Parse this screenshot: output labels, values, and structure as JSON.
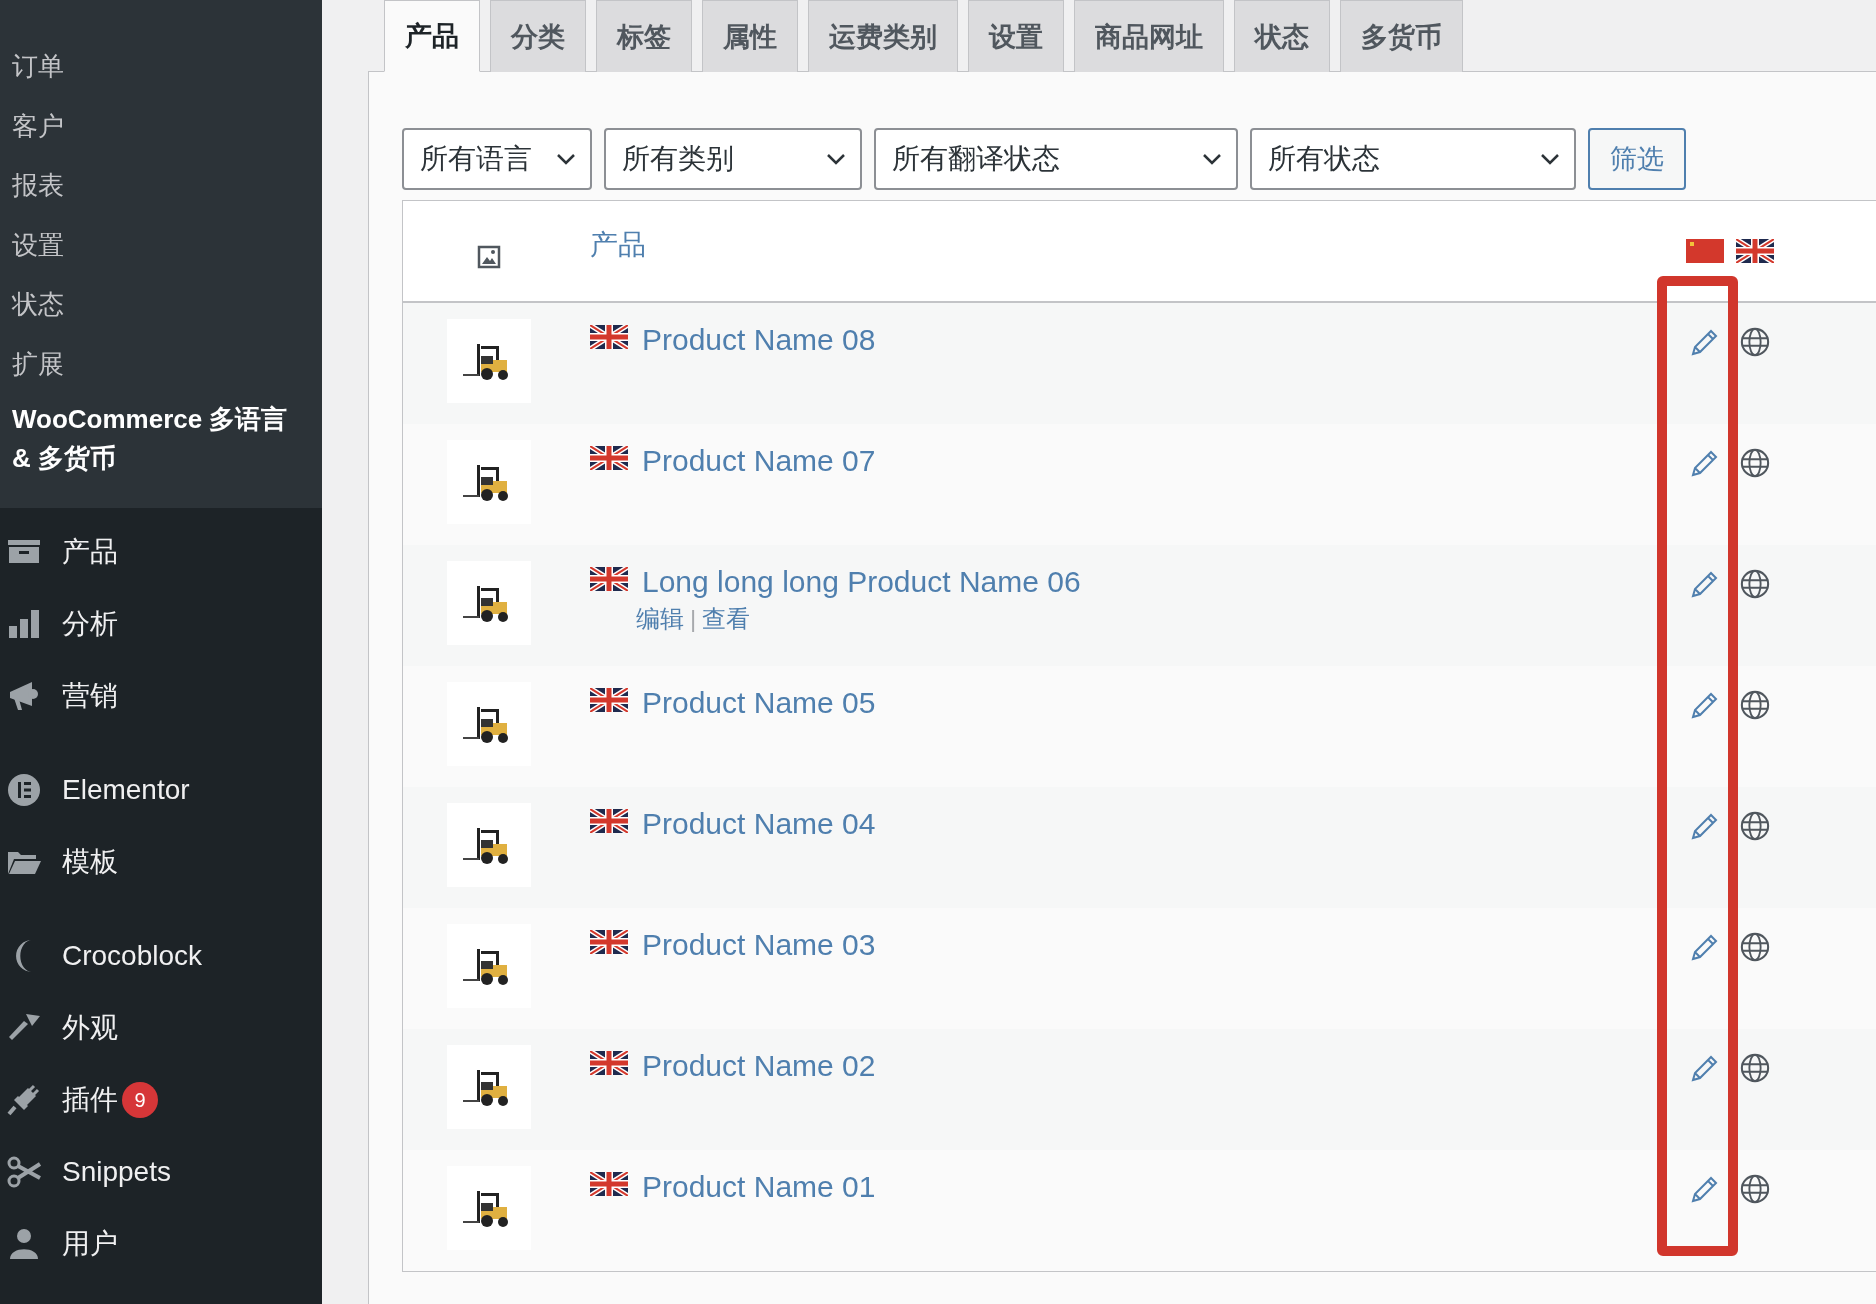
{
  "sidebar": {
    "submenu": [
      {
        "label": "订单"
      },
      {
        "label": "客户"
      },
      {
        "label": "报表"
      },
      {
        "label": "设置"
      },
      {
        "label": "状态"
      },
      {
        "label": "扩展"
      }
    ],
    "current_plugin": "WooCommerce 多语言 & 多货币",
    "menu_groups": [
      [
        {
          "label": "产品"
        },
        {
          "label": "分析"
        },
        {
          "label": "营销"
        }
      ],
      [
        {
          "label": "Elementor"
        },
        {
          "label": "模板"
        }
      ],
      [
        {
          "label": "Crocoblock"
        },
        {
          "label": "外观"
        },
        {
          "label": "插件",
          "badge": "9"
        },
        {
          "label": "Snippets"
        },
        {
          "label": "用户"
        }
      ]
    ]
  },
  "tabs": [
    {
      "label": "产品",
      "selected": true
    },
    {
      "label": "分类",
      "selected": false
    },
    {
      "label": "标签",
      "selected": false
    },
    {
      "label": "属性",
      "selected": false
    },
    {
      "label": "运费类别",
      "selected": false
    },
    {
      "label": "设置",
      "selected": false
    },
    {
      "label": "商品网址",
      "selected": false
    },
    {
      "label": "状态",
      "selected": false
    },
    {
      "label": "多货币",
      "selected": false
    }
  ],
  "filters": [
    {
      "value": "所有语言"
    },
    {
      "value": "所有类别"
    },
    {
      "value": "所有翻译状态"
    },
    {
      "value": "所有状态"
    }
  ],
  "filter_button": "筛选",
  "table": {
    "product_column": "产品",
    "rows": [
      {
        "name": "Product Name 08"
      },
      {
        "name": "Product Name 07"
      },
      {
        "name": "Long long long Product Name 06",
        "actions": [
          {
            "label": "编辑"
          },
          {
            "label": "查看"
          }
        ],
        "action_separator": "|"
      },
      {
        "name": "Product Name 05"
      },
      {
        "name": "Product Name 04"
      },
      {
        "name": "Product Name 03"
      },
      {
        "name": "Product Name 02"
      },
      {
        "name": "Product Name 01"
      }
    ]
  }
}
